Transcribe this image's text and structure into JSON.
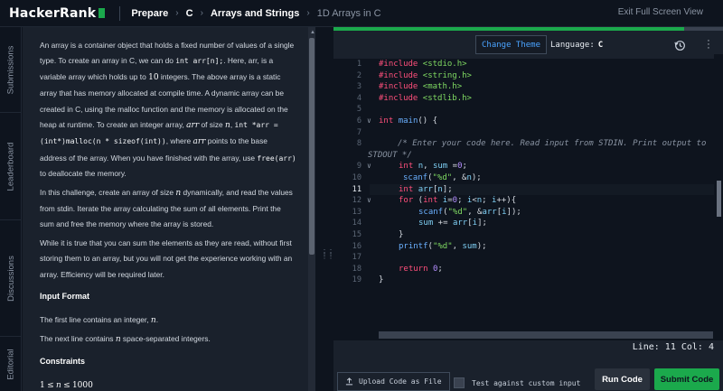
{
  "topbar": {
    "logo": "HackerRank",
    "breadcrumbs": [
      {
        "label": "Prepare"
      },
      {
        "label": "C"
      },
      {
        "label": "Arrays and Strings"
      },
      {
        "label": "1D Arrays in C"
      }
    ],
    "exit_fullscreen": "Exit Full Screen View"
  },
  "vtabs": [
    "Submissions",
    "Leaderboard",
    "Discussions",
    "Editorial"
  ],
  "problem": {
    "p1": {
      "a": "An array is a container object that holds a fixed number of values of a single type. To create an array in C, we can do ",
      "code1": "int arr[n];",
      "b": ". Here, arr, is a variable array which holds up to ",
      "num10": "10",
      "c": " integers. The above array is a static array that has memory allocated at compile time. A dynamic array can be created in C, using the malloc function and the memory is allocated on the heap at runtime. To create an integer array, ",
      "arr1": "arr",
      "d": " of size ",
      "n1": "n",
      "e": ", ",
      "code2": "int *arr = (int*)malloc(n * sizeof(int))",
      "f": ", where ",
      "arr2": "arr",
      "g": " points to the base address of the array. When you have finished with the array, use ",
      "code3": "free(arr)",
      "h": " to deallocate the memory."
    },
    "p2": {
      "a": "In this challenge, create an array of size ",
      "n": "n",
      "b": " dynamically, and read the values from stdin. Iterate the array calculating the sum of all elements. Print the sum and free the memory where the array is stored."
    },
    "p3": "While it is true that you can sum the elements as they are read, without first storing them to an array, but you will not get the experience working with an array. Efficiency will be required later.",
    "input_format_title": "Input Format",
    "input1": {
      "a": "The first line contains an integer, ",
      "n": "n",
      "b": "."
    },
    "input2": {
      "a": "The next line contains ",
      "n": "n",
      "b": " space-separated integers."
    },
    "constraints_title": "Constraints",
    "constraint": {
      "one": "1",
      "le1": "≤",
      "n": "n",
      "le2": "≤",
      "max": "1000"
    }
  },
  "editor": {
    "progress": 0.9,
    "change_theme": "Change Theme",
    "language_label": "Language:",
    "language_value": "C",
    "status": "Line: 11 Col: 4",
    "upload": "Upload Code as File",
    "custom_input": "Test against custom input",
    "run": "Run Code",
    "submit": "Submit Code",
    "lines": [
      {
        "n": "1"
      },
      {
        "n": "2"
      },
      {
        "n": "3"
      },
      {
        "n": "4"
      },
      {
        "n": "5"
      },
      {
        "n": "6"
      },
      {
        "n": "7"
      },
      {
        "n": "8"
      },
      {
        "n": ""
      },
      {
        "n": "9"
      },
      {
        "n": "10"
      },
      {
        "n": "11"
      },
      {
        "n": "12"
      },
      {
        "n": "13"
      },
      {
        "n": "14"
      },
      {
        "n": "15"
      },
      {
        "n": "16"
      },
      {
        "n": "17"
      },
      {
        "n": "18"
      },
      {
        "n": "19"
      }
    ],
    "code": {
      "l1": {
        "kw": "#include",
        "str": "<stdio.h>"
      },
      "l2": {
        "kw": "#include",
        "str": "<string.h>"
      },
      "l3": {
        "kw": "#include",
        "str": "<math.h>"
      },
      "l4": {
        "kw": "#include",
        "str": "<stdlib.h>"
      },
      "l6": {
        "kw": "int",
        "fn": "main",
        "rest": "() {"
      },
      "l8": "/* Enter your code here. Read input from STDIN. Print output to",
      "l8b": "STDOUT */",
      "l9": {
        "kw": "int",
        "a": "n",
        "b": ", ",
        "c": "sum",
        "d": " =",
        "e": "0",
        "f": ";"
      },
      "l10": {
        "fn": "scanf",
        "a": "(",
        "s": "\"%d\"",
        "b": ", &",
        "c": "n",
        "d": ");"
      },
      "l11": {
        "kw": "int",
        "a": "arr",
        "b": "[",
        "c": "n",
        "d": "];"
      },
      "l12": {
        "kw": "for",
        "a": " (",
        "t": "int",
        "b": " ",
        "c": "i",
        "d": "=",
        "e": "0",
        "f": "; ",
        "g": "i",
        "h": "<",
        "i": "n",
        "j": "; ",
        "k": "i",
        "l": "++){"
      },
      "l13": {
        "fn": "scanf",
        "a": "(",
        "s": "\"%d\"",
        "b": ", &",
        "c": "arr",
        "d": "[",
        "e": "i",
        "f": "]);"
      },
      "l14": {
        "a": "sum",
        "b": " += ",
        "c": "arr",
        "d": "[",
        "e": "i",
        "f": "];"
      },
      "l15": "}",
      "l16": {
        "fn": "printf",
        "a": "(",
        "s": "\"%d\"",
        "b": ", ",
        "c": "sum",
        "d": ");"
      },
      "l18": {
        "kw": "return",
        "a": " ",
        "b": "0",
        "c": ";"
      },
      "l19": "}"
    }
  }
}
